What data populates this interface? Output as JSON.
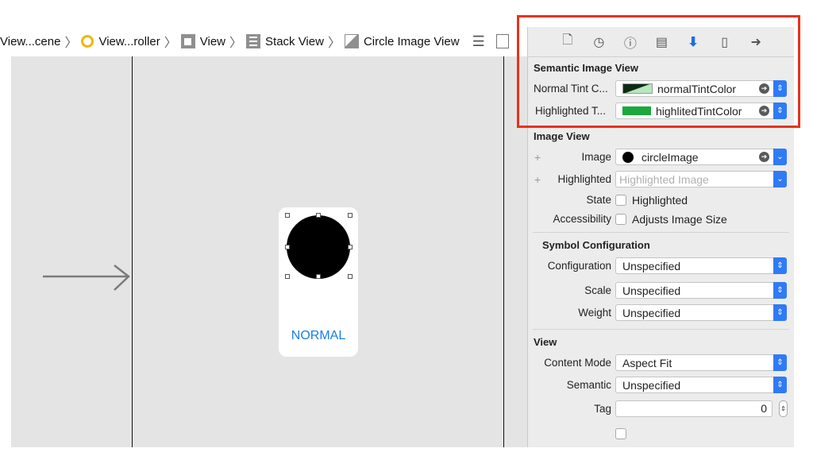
{
  "breadcrumb": {
    "items": [
      {
        "label": "View...cene",
        "icon": "none"
      },
      {
        "label": "View...roller",
        "icon": "view-controller-icon"
      },
      {
        "label": "View",
        "icon": "view-icon"
      },
      {
        "label": "Stack View",
        "icon": "stack-view-icon"
      },
      {
        "label": "Circle Image View",
        "icon": "image-view-icon"
      }
    ]
  },
  "canvas": {
    "button_label": "NORMAL",
    "accent": "#1a7ee8"
  },
  "inspector": {
    "toolbar_icons": [
      "file-inspector-icon",
      "history-inspector-icon",
      "quick-help-icon",
      "identity-inspector-icon",
      "attributes-inspector-icon",
      "size-inspector-icon",
      "connections-inspector-icon"
    ],
    "active_tab": "attributes-inspector-icon",
    "semantic": {
      "title": "Semantic Image View",
      "normal_label": "Normal Tint C...",
      "normal_value": "normalTintColor",
      "highlighted_label": "Highlighted T...",
      "highlighted_value": "highlitedTintColor",
      "highlighted_color": "#1aa93a"
    },
    "image_view": {
      "title": "Image View",
      "image_label": "Image",
      "image_value": "circleImage",
      "highlighted_label": "Highlighted",
      "highlighted_placeholder": "Highlighted Image",
      "state_label": "State",
      "state_option": "Highlighted",
      "accessibility_label": "Accessibility",
      "accessibility_option": "Adjusts Image Size"
    },
    "symbol": {
      "title": "Symbol Configuration",
      "configuration_label": "Configuration",
      "configuration_value": "Unspecified",
      "scale_label": "Scale",
      "scale_value": "Unspecified",
      "weight_label": "Weight",
      "weight_value": "Unspecified"
    },
    "view": {
      "title": "View",
      "content_mode_label": "Content Mode",
      "content_mode_value": "Aspect Fit",
      "semantic_label": "Semantic",
      "semantic_value": "Unspecified",
      "tag_label": "Tag",
      "tag_value": "0"
    }
  },
  "colors": {
    "annotation_box": "#e8321e",
    "selected_spinner": "#2f7bf6"
  }
}
